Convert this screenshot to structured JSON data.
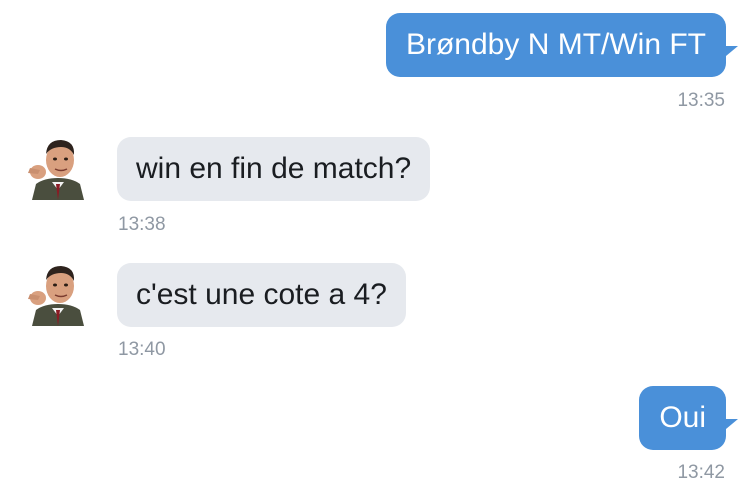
{
  "messages": [
    {
      "direction": "outgoing",
      "text": "Brøndby N MT/Win FT",
      "time": "13:35"
    },
    {
      "direction": "incoming",
      "text": "win en fin de match?",
      "time": "13:38",
      "avatar": "user-avatar"
    },
    {
      "direction": "incoming",
      "text": "c'est une cote a 4?",
      "time": "13:40",
      "avatar": "user-avatar"
    },
    {
      "direction": "outgoing",
      "text": "Oui",
      "time": "13:42"
    }
  ],
  "colors": {
    "outgoing_bubble": "#4a90d9",
    "incoming_bubble": "#e6e9ee",
    "timestamp": "#8f98a3"
  }
}
